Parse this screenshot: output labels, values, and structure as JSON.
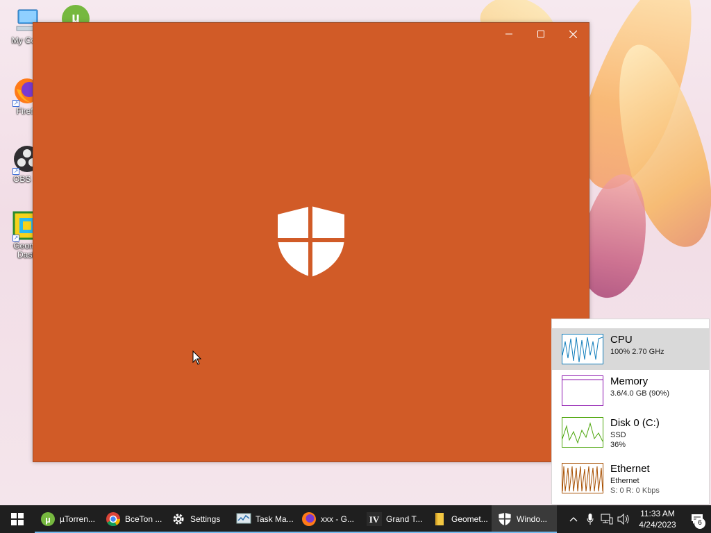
{
  "desktop": {
    "icons": [
      {
        "label": "My Com",
        "icon": "computer-icon"
      },
      {
        "label": "Firefo",
        "icon": "firefox-icon"
      },
      {
        "label": "OBS St",
        "icon": "obs-icon"
      },
      {
        "label": "Geome\nDash",
        "icon": "geometry-dash-icon"
      },
      {
        "label": "",
        "icon": "utorrent-icon"
      }
    ]
  },
  "window": {
    "minimize": "—",
    "maximize": "☐",
    "close": "✕",
    "background_color": "#d15b27",
    "icon": "windows-security-shield-icon"
  },
  "perf_panel": {
    "items": [
      {
        "title": "CPU",
        "line1": "100%  2.70 GHz",
        "line2": "",
        "color": "#117dbb",
        "selected": true
      },
      {
        "title": "Memory",
        "line1": "3.6/4.0 GB (90%)",
        "line2": "",
        "color": "#8b12ae",
        "selected": false
      },
      {
        "title": "Disk 0 (C:)",
        "line1": "SSD",
        "line2": "36%",
        "color": "#4da60c",
        "selected": false
      },
      {
        "title": "Ethernet",
        "line1": "Ethernet",
        "line2": "S: 0  R: 0 Kbps",
        "color": "#a74f01",
        "selected": false
      }
    ]
  },
  "taskbar": {
    "items": [
      {
        "label": "µTorren...",
        "icon": "utorrent-icon",
        "active": false
      },
      {
        "label": "BceTon ...",
        "icon": "chrome-icon",
        "active": false
      },
      {
        "label": "Settings",
        "icon": "settings-gear-icon",
        "active": false
      },
      {
        "label": "Task Ma...",
        "icon": "task-manager-icon",
        "active": false
      },
      {
        "label": "xxx - G...",
        "icon": "firefox-icon",
        "active": false
      },
      {
        "label": "Grand T...",
        "icon": "gta-iv-icon",
        "active": false
      },
      {
        "label": "Geomet...",
        "icon": "folder-icon",
        "active": false
      },
      {
        "label": "Windo...",
        "icon": "windows-security-icon",
        "active": true
      }
    ],
    "tray": {
      "time": "11:33 AM",
      "date": "4/24/2023",
      "notification_count": "6"
    }
  }
}
